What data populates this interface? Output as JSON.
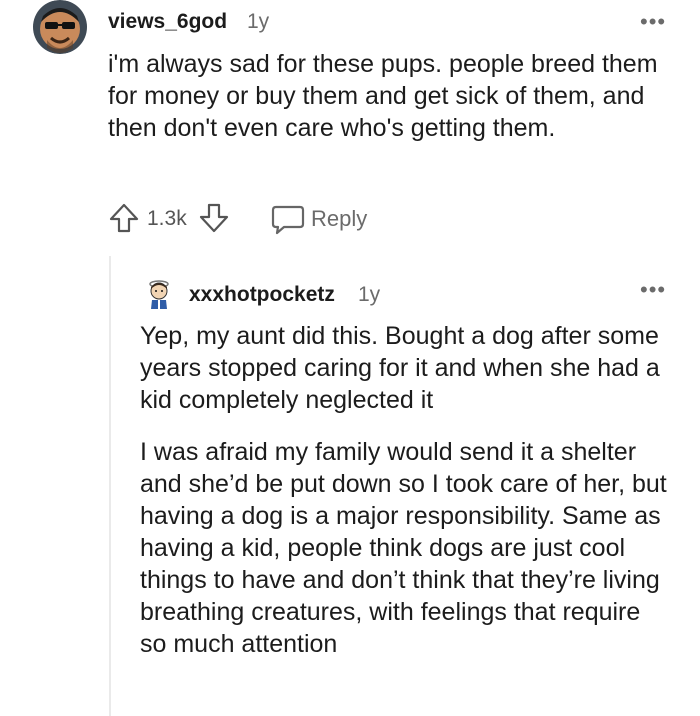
{
  "comment": {
    "username": "views_6god",
    "age": "1y",
    "more": "•••",
    "body": "i'm always sad for these pups. people breed them for money or buy them and get sick of them, and then don't even care who's getting them.",
    "votes": "1.3k",
    "reply_label": "Reply"
  },
  "reply": {
    "username": "xxxhotpocketz",
    "age": "1y",
    "more": "•••",
    "paragraphs": [
      "Yep, my aunt did this. Bought a dog after some years stopped caring for it and when she had a kid completely neglected it",
      "I was afraid my family would send it a shelter and she’d be put down so I took care of her, but having a dog is a major responsibility. Same as having a kid, people think dogs are just cool things to have and don’t think that they’re living breathing creatures, with feelings that require so much attention"
    ]
  },
  "icons": {
    "upvote": "upvote-arrow-icon",
    "downvote": "downvote-arrow-icon",
    "reply": "speech-bubble-icon",
    "more": "overflow-dots-icon"
  }
}
